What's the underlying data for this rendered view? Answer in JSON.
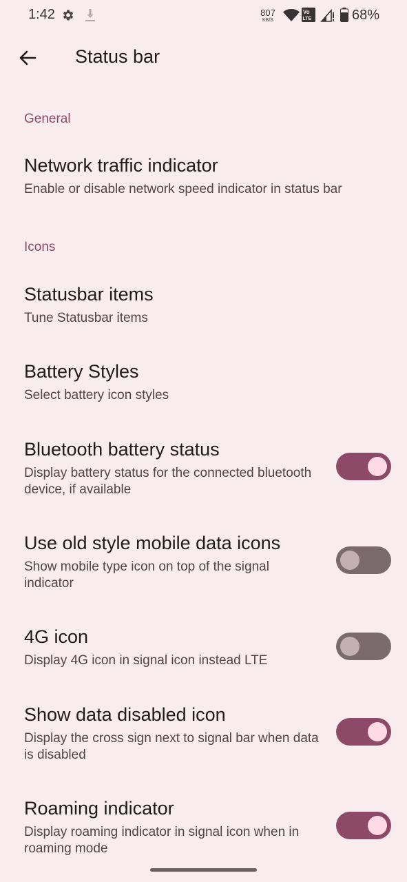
{
  "status_bar": {
    "time": "1:42",
    "net_speed_value": "807",
    "net_speed_unit": "KB/S",
    "volte_label_top": "Vo",
    "volte_label_bottom": "LTE",
    "battery_percent": "68%",
    "icons": [
      "gear-icon",
      "download-icon",
      "wifi-icon",
      "volte-icon",
      "signal-icon",
      "battery-icon"
    ]
  },
  "app_bar": {
    "title": "Status bar",
    "back_icon": "arrow-back-icon"
  },
  "sections": {
    "general": "General",
    "icons": "Icons"
  },
  "prefs": {
    "network_traffic": {
      "title": "Network traffic indicator",
      "summary": "Enable or disable network speed indicator in status bar"
    },
    "statusbar_items": {
      "title": "Statusbar items",
      "summary": "Tune Statusbar items"
    },
    "battery_styles": {
      "title": "Battery Styles",
      "summary": "Select battery icon styles"
    },
    "bluetooth_battery": {
      "title": "Bluetooth battery status",
      "summary": "Display battery status for the connected bluetooth device, if available",
      "enabled": true
    },
    "old_mobile_icons": {
      "title": "Use old style mobile data icons",
      "summary": "Show mobile type icon on top of the signal indicator",
      "enabled": false
    },
    "icon_4g": {
      "title": "4G icon",
      "summary": "Display 4G icon in signal icon instead LTE",
      "enabled": false
    },
    "data_disabled": {
      "title": "Show data disabled icon",
      "summary": "Display the cross sign next to signal bar when data is disabled",
      "enabled": true
    },
    "roaming": {
      "title": "Roaming indicator",
      "summary": "Display roaming indicator in signal icon when in roaming mode",
      "enabled": true
    }
  },
  "colors": {
    "background": "#f9ecee",
    "accent": "#8c4a68",
    "section_header": "#8a4a68",
    "toggle_off": "#7a6a6e"
  }
}
